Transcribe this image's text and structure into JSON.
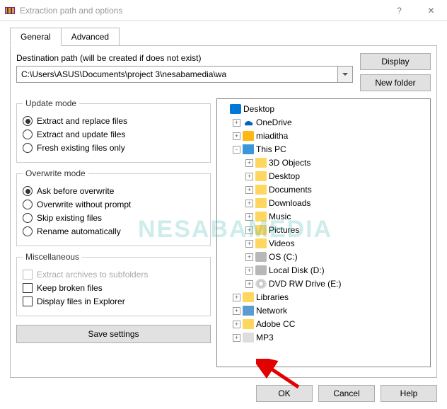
{
  "title": "Extraction path and options",
  "titlebar": {
    "help": "?",
    "close": "✕"
  },
  "tabs": {
    "general": "General",
    "advanced": "Advanced"
  },
  "destination": {
    "label": "Destination path (will be created if does not exist)",
    "value": "C:\\Users\\ASUS\\Documents\\project 3\\nesabamedia\\wa",
    "display_btn": "Display",
    "newfolder_btn": "New folder"
  },
  "update_mode": {
    "legend": "Update mode",
    "opt1": "Extract and replace files",
    "opt2": "Extract and update files",
    "opt3": "Fresh existing files only"
  },
  "overwrite_mode": {
    "legend": "Overwrite mode",
    "opt1": "Ask before overwrite",
    "opt2": "Overwrite without prompt",
    "opt3": "Skip existing files",
    "opt4": "Rename automatically"
  },
  "misc": {
    "legend": "Miscellaneous",
    "opt1": "Extract archives to subfolders",
    "opt2": "Keep broken files",
    "opt3": "Display files in Explorer"
  },
  "save_settings": "Save settings",
  "tree": [
    {
      "indent": 0,
      "exp": "",
      "icon": "desktop",
      "label": "Desktop"
    },
    {
      "indent": 1,
      "exp": "+",
      "icon": "onedrive",
      "label": "OneDrive"
    },
    {
      "indent": 1,
      "exp": "+",
      "icon": "user",
      "label": "miaditha"
    },
    {
      "indent": 1,
      "exp": "-",
      "icon": "pc",
      "label": "This PC"
    },
    {
      "indent": 2,
      "exp": "+",
      "icon": "folder",
      "label": "3D Objects"
    },
    {
      "indent": 2,
      "exp": "+",
      "icon": "folder",
      "label": "Desktop"
    },
    {
      "indent": 2,
      "exp": "+",
      "icon": "folder",
      "label": "Documents"
    },
    {
      "indent": 2,
      "exp": "+",
      "icon": "folder",
      "label": "Downloads"
    },
    {
      "indent": 2,
      "exp": "+",
      "icon": "folder",
      "label": "Music"
    },
    {
      "indent": 2,
      "exp": "+",
      "icon": "folder",
      "label": "Pictures"
    },
    {
      "indent": 2,
      "exp": "+",
      "icon": "folder",
      "label": "Videos"
    },
    {
      "indent": 2,
      "exp": "+",
      "icon": "drive",
      "label": "OS (C:)"
    },
    {
      "indent": 2,
      "exp": "+",
      "icon": "drive",
      "label": "Local Disk (D:)"
    },
    {
      "indent": 2,
      "exp": "+",
      "icon": "dvd",
      "label": "DVD RW Drive (E:)"
    },
    {
      "indent": 1,
      "exp": "+",
      "icon": "folder",
      "label": "Libraries"
    },
    {
      "indent": 1,
      "exp": "+",
      "icon": "network",
      "label": "Network"
    },
    {
      "indent": 1,
      "exp": "+",
      "icon": "folder",
      "label": "Adobe CC"
    },
    {
      "indent": 1,
      "exp": "+",
      "icon": "music",
      "label": "MP3"
    }
  ],
  "buttons": {
    "ok": "OK",
    "cancel": "Cancel",
    "help": "Help"
  },
  "watermark": "NESABAMEDIA"
}
